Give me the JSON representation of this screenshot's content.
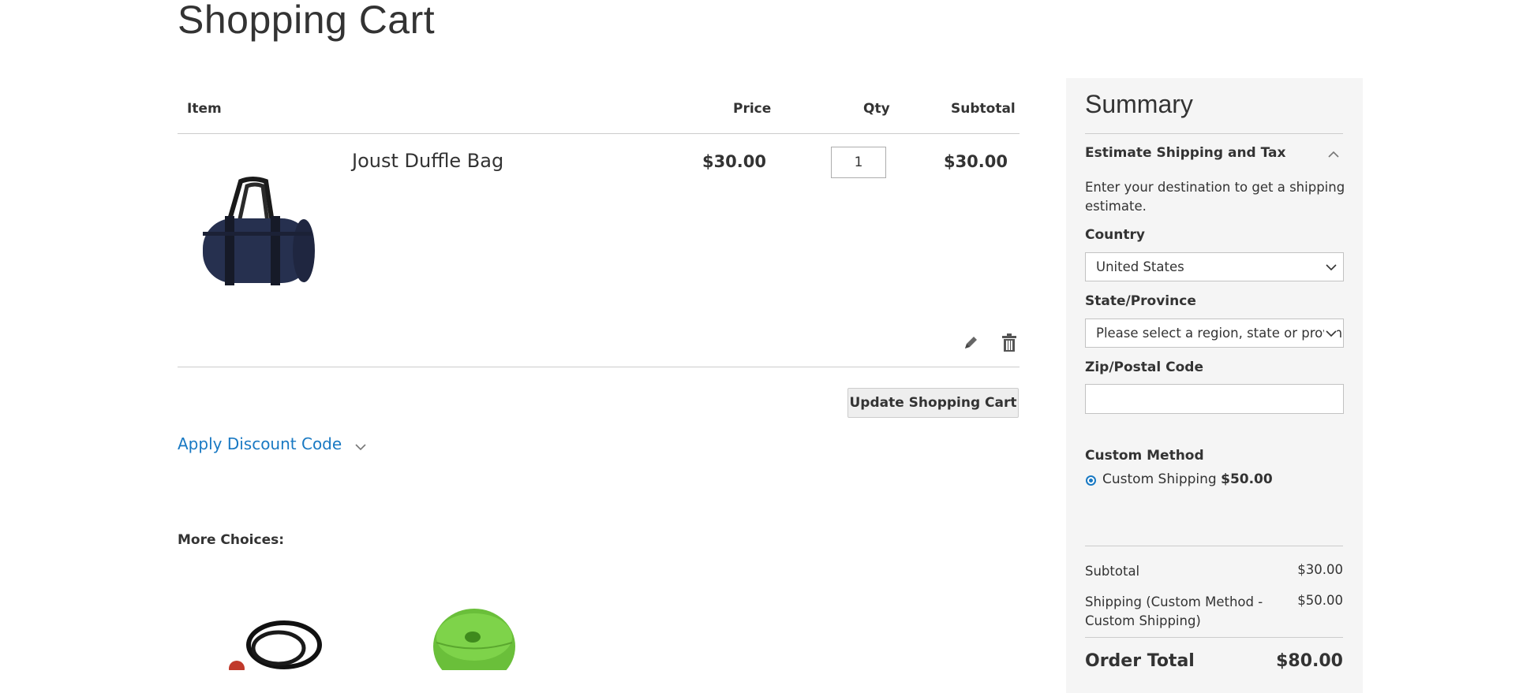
{
  "page": {
    "title": "Shopping Cart"
  },
  "cart": {
    "headers": {
      "item": "Item",
      "price": "Price",
      "qty": "Qty",
      "subtotal": "Subtotal"
    },
    "item": {
      "name": "Joust Duffle Bag",
      "price": "$30.00",
      "qty": "1",
      "subtotal": "$30.00",
      "image": "duffle-bag"
    },
    "actions": {
      "edit_icon": "pencil-icon",
      "delete_icon": "trash-icon"
    },
    "update_button": "Update Shopping Cart",
    "discount_link": "Apply Discount Code",
    "more_choices": "More Choices:"
  },
  "summary": {
    "title": "Summary",
    "estimate": {
      "heading": "Estimate Shipping and Tax",
      "hint": "Enter your destination to get a shipping estimate.",
      "country_label": "Country",
      "country_value": "United States",
      "state_label": "State/Province",
      "state_value": "Please select a region, state or province.",
      "zip_label": "Zip/Postal Code",
      "zip_value": ""
    },
    "method": {
      "title": "Custom Method",
      "option_label": "Custom Shipping",
      "option_price": "$50.00"
    },
    "totals": {
      "subtotal_label": "Subtotal",
      "subtotal_value": "$30.00",
      "shipping_label": "Shipping (Custom Method - Custom Shipping)",
      "shipping_value": "$50.00",
      "order_total_label": "Order Total",
      "order_total_value": "$80.00"
    }
  },
  "colors": {
    "link": "#1979c3",
    "summary_bg": "#f5f5f5"
  }
}
